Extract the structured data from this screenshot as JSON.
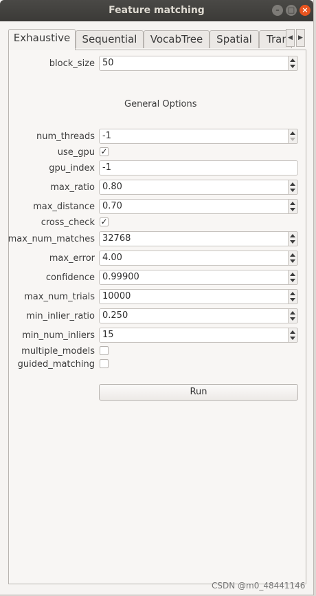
{
  "window": {
    "title": "Feature matching",
    "controls": [
      "minimize",
      "maximize",
      "close"
    ]
  },
  "tabs": [
    "Exhaustive",
    "Sequential",
    "VocabTree",
    "Spatial",
    "Tran"
  ],
  "active_tab": "Exhaustive",
  "fields": {
    "block_size": {
      "label": "block_size",
      "value": "50"
    },
    "num_threads": {
      "label": "num_threads",
      "value": "-1"
    },
    "use_gpu": {
      "label": "use_gpu",
      "checked": true
    },
    "gpu_index": {
      "label": "gpu_index",
      "value": "-1"
    },
    "max_ratio": {
      "label": "max_ratio",
      "value": "0.80"
    },
    "max_distance": {
      "label": "max_distance",
      "value": "0.70"
    },
    "cross_check": {
      "label": "cross_check",
      "checked": true
    },
    "max_num_matches": {
      "label": "max_num_matches",
      "value": "32768"
    },
    "max_error": {
      "label": "max_error",
      "value": "4.00"
    },
    "confidence": {
      "label": "confidence",
      "value": "0.99900"
    },
    "max_num_trials": {
      "label": "max_num_trials",
      "value": "10000"
    },
    "min_inlier_ratio": {
      "label": "min_inlier_ratio",
      "value": "0.250"
    },
    "min_num_inliers": {
      "label": "min_num_inliers",
      "value": "15"
    },
    "multiple_models": {
      "label": "multiple_models",
      "checked": false
    },
    "guided_matching": {
      "label": "guided_matching",
      "checked": false
    }
  },
  "section_title": "General Options",
  "run_label": "Run",
  "watermark": "CSDN @m0_48441146"
}
